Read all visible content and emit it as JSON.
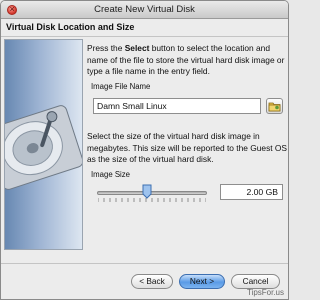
{
  "window": {
    "title": "Create New Virtual Disk"
  },
  "header": {
    "title": "Virtual Disk Location and Size"
  },
  "location": {
    "text_before": "Press the ",
    "text_bold": "Select",
    "text_after": " button to select the location and name of the file to store the virtual hard disk image or type a file name in the entry field.",
    "group_label": "Image File Name",
    "file_name": "Damn Small Linux",
    "folder_icon": "folder-icon"
  },
  "size": {
    "description": "Select the size of the virtual hard disk image in megabytes. This size will be reported to the Guest OS as the size of the virtual hard disk.",
    "group_label": "Image Size",
    "slider_level": 0.45,
    "value": "2.00 GB"
  },
  "buttons": {
    "back": "< Back",
    "next": "Next >",
    "cancel": "Cancel"
  },
  "watermark": "TipsFor.us",
  "colors": {
    "default_button": "#5a9be6",
    "close_button": "#d0342a"
  }
}
